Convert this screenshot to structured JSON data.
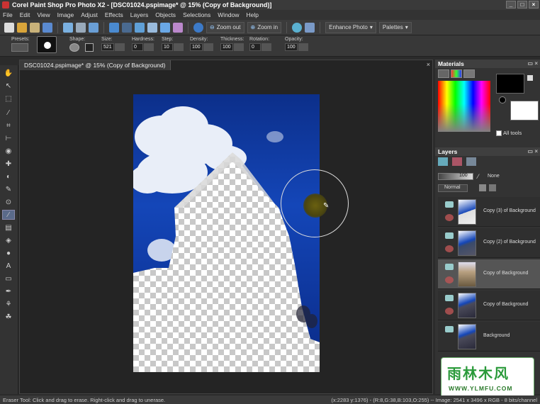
{
  "window": {
    "title": "Corel Paint Shop Pro Photo X2 - [DSC01024.pspimage* @  15% (Copy of Background)]"
  },
  "menu": [
    "File",
    "Edit",
    "View",
    "Image",
    "Adjust",
    "Effects",
    "Layers",
    "Objects",
    "Selections",
    "Window",
    "Help"
  ],
  "toolbar": {
    "zoom_out": "Zoom out",
    "zoom_in": "Zoom in",
    "enhance_photo": "Enhance Photo",
    "palettes": "Palettes"
  },
  "options": {
    "presets_label": "Presets:",
    "shape_label": "Shape:",
    "size_label": "Size:",
    "size": "521",
    "hardness_label": "Hardness:",
    "hardness": "0",
    "step_label": "Step:",
    "step": "10",
    "density_label": "Density:",
    "density": "100",
    "thickness_label": "Thickness:",
    "thickness": "100",
    "rotation_label": "Rotation:",
    "rotation": "0",
    "opacity_label": "Opacity:",
    "opacity": "100"
  },
  "document": {
    "tab": "DSC01024.pspimage* @  15% (Copy of Background)"
  },
  "materials": {
    "title": "Materials",
    "all_tools": "All tools"
  },
  "layers_panel": {
    "title": "Layers",
    "opacity": "100",
    "blend_mode": "Normal",
    "mask": "None",
    "items": [
      {
        "name": "Copy (3) of Background"
      },
      {
        "name": "Copy (2) of Background"
      },
      {
        "name": "Copy of Background"
      },
      {
        "name": "Copy of Background"
      },
      {
        "name": "Background"
      }
    ]
  },
  "status": {
    "left": "Eraser Tool: Click and drag to erase. Right-click and drag to unerase.",
    "right": "(x:2283 y:1376) - (R:8,G:38,B:103,O:255) -- Image: 2541 x 3496 x RGB - 8 bits/channel"
  },
  "watermark": {
    "line1": "雨林木风",
    "line2": "WWW.YLMFU.COM"
  }
}
